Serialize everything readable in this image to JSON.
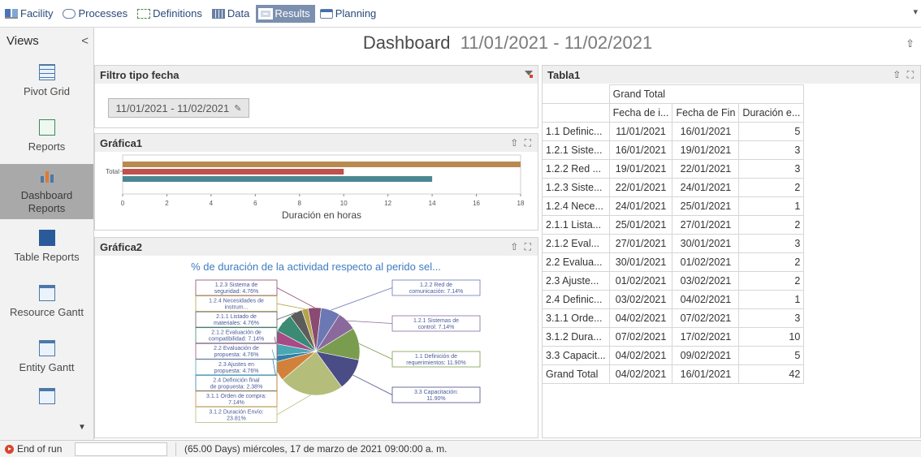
{
  "tabs": [
    {
      "label": "Facility",
      "icon": "facility-icon",
      "active": false
    },
    {
      "label": "Processes",
      "icon": "processes-icon",
      "active": false
    },
    {
      "label": "Definitions",
      "icon": "definitions-icon",
      "active": false
    },
    {
      "label": "Data",
      "icon": "data-icon",
      "active": false
    },
    {
      "label": "Results",
      "icon": "results-icon",
      "active": true
    },
    {
      "label": "Planning",
      "icon": "planning-icon",
      "active": false
    }
  ],
  "sidebar": {
    "title": "Views",
    "collapse": "<",
    "items": [
      {
        "label": "Pivot Grid",
        "icon": "pivot-grid-icon"
      },
      {
        "label": "Reports",
        "icon": "reports-icon"
      },
      {
        "label": "Dashboard Reports",
        "icon": "dashboard-reports-icon",
        "selected": true
      },
      {
        "label": "Table Reports",
        "icon": "table-reports-icon"
      },
      {
        "label": "Resource Gantt",
        "icon": "resource-gantt-icon"
      },
      {
        "label": "Entity Gantt",
        "icon": "entity-gantt-icon"
      },
      {
        "label": "",
        "icon": "more-reports-icon"
      }
    ]
  },
  "dashboard": {
    "title": "Dashboard",
    "date_range": "11/01/2021 - 11/02/2021"
  },
  "filter_panel": {
    "title": "Filtro tipo fecha",
    "value": "11/01/2021 - 11/02/2021"
  },
  "grafica1": {
    "title": "Gráfica1",
    "xlabel": "Duración en horas"
  },
  "grafica2": {
    "title": "Gráfica2",
    "chart_title": "% de duración de la actividad respecto al perido sel..."
  },
  "tabla1": {
    "title": "Tabla1",
    "group_header": "Grand Total",
    "columns": [
      "Fecha de i...",
      "Fecha de Fin",
      "Duración e..."
    ],
    "rows": [
      {
        "name": "1.1 Definic...",
        "start": "11/01/2021",
        "end": "16/01/2021",
        "dur": "5"
      },
      {
        "name": "1.2.1 Siste...",
        "start": "16/01/2021",
        "end": "19/01/2021",
        "dur": "3"
      },
      {
        "name": "1.2.2 Red ...",
        "start": "19/01/2021",
        "end": "22/01/2021",
        "dur": "3"
      },
      {
        "name": "1.2.3 Siste...",
        "start": "22/01/2021",
        "end": "24/01/2021",
        "dur": "2"
      },
      {
        "name": "1.2.4 Nece...",
        "start": "24/01/2021",
        "end": "25/01/2021",
        "dur": "1"
      },
      {
        "name": "2.1.1 Lista...",
        "start": "25/01/2021",
        "end": "27/01/2021",
        "dur": "2"
      },
      {
        "name": "2.1.2 Eval...",
        "start": "27/01/2021",
        "end": "30/01/2021",
        "dur": "3"
      },
      {
        "name": "2.2 Evalua...",
        "start": "30/01/2021",
        "end": "01/02/2021",
        "dur": "2"
      },
      {
        "name": "2.3 Ajuste...",
        "start": "01/02/2021",
        "end": "03/02/2021",
        "dur": "2"
      },
      {
        "name": "2.4 Definic...",
        "start": "03/02/2021",
        "end": "04/02/2021",
        "dur": "1"
      },
      {
        "name": "3.1.1 Orde...",
        "start": "04/02/2021",
        "end": "07/02/2021",
        "dur": "3"
      },
      {
        "name": "3.1.2 Dura...",
        "start": "07/02/2021",
        "end": "17/02/2021",
        "dur": "10"
      },
      {
        "name": "3.3 Capacit...",
        "start": "04/02/2021",
        "end": "09/02/2021",
        "dur": "5"
      }
    ],
    "total": {
      "name": "Grand Total",
      "start": "04/02/2021",
      "end": "16/01/2021",
      "dur": "42"
    }
  },
  "status": {
    "state": "End of run",
    "info": "(65.00 Days) miércoles, 17 de marzo de 2021 09:00:00 a. m."
  },
  "chart_data": [
    {
      "type": "bar",
      "orientation": "horizontal",
      "title": "Gráfica1",
      "categories": [
        "Total"
      ],
      "series": [
        {
          "values": [
            18
          ],
          "color": "#b98a4f"
        },
        {
          "values": [
            10
          ],
          "color": "#c0504d"
        },
        {
          "values": [
            14
          ],
          "color": "#4b8793"
        }
      ],
      "xlabel": "Duración en horas",
      "xlim": [
        0,
        18
      ],
      "xticks": [
        "0",
        "2",
        "4",
        "6",
        "8",
        "10",
        "12",
        "14",
        "16",
        "18"
      ],
      "legend": "none"
    },
    {
      "type": "pie",
      "title": "% de duración de la actividad respecto al perido sel...",
      "slices": [
        {
          "label": "1.2.2 Red de comunicación: 7.14%",
          "value": 7.14,
          "color": "#6b78b4"
        },
        {
          "label": "1.2.1 Sistemas de control: 7.14%",
          "value": 7.14,
          "color": "#8a6a9c"
        },
        {
          "label": "1.1 Definición de requerimientos: 11.90%",
          "value": 11.9,
          "color": "#7a9c4f"
        },
        {
          "label": "3.3 Capacitación: 11.90%",
          "value": 11.9,
          "color": "#4a4c86"
        },
        {
          "label": "3.1.2 Duración Envío: 23.81%",
          "value": 23.81,
          "color": "#b4bd7a"
        },
        {
          "label": "3.1.1 Orden de compra: 7.14%",
          "value": 7.14,
          "color": "#d1813a"
        },
        {
          "label": "2.4 Definición final de propuesta: 2.38%",
          "value": 2.38,
          "color": "#2f7fa8"
        },
        {
          "label": "2.3 Ajustes en propuesta: 4.76%",
          "value": 4.76,
          "color": "#49a8b2"
        },
        {
          "label": "2.2 Evaluación de propuesta: 4.76%",
          "value": 4.76,
          "color": "#a74a86"
        },
        {
          "label": "2.1.2 Evaluación de compatibilidad: 7.14%",
          "value": 7.14,
          "color": "#3a8a74"
        },
        {
          "label": "2.1.1 Listado de materiales: 4.76%",
          "value": 4.76,
          "color": "#5c5c5c"
        },
        {
          "label": "1.2.4 Necesidades de instrum...",
          "value": 2.38,
          "color": "#b4a44a"
        },
        {
          "label": "1.2.3 Sistema de seguridad: 4.76%",
          "value": 4.76,
          "color": "#8a4a72"
        }
      ]
    }
  ]
}
